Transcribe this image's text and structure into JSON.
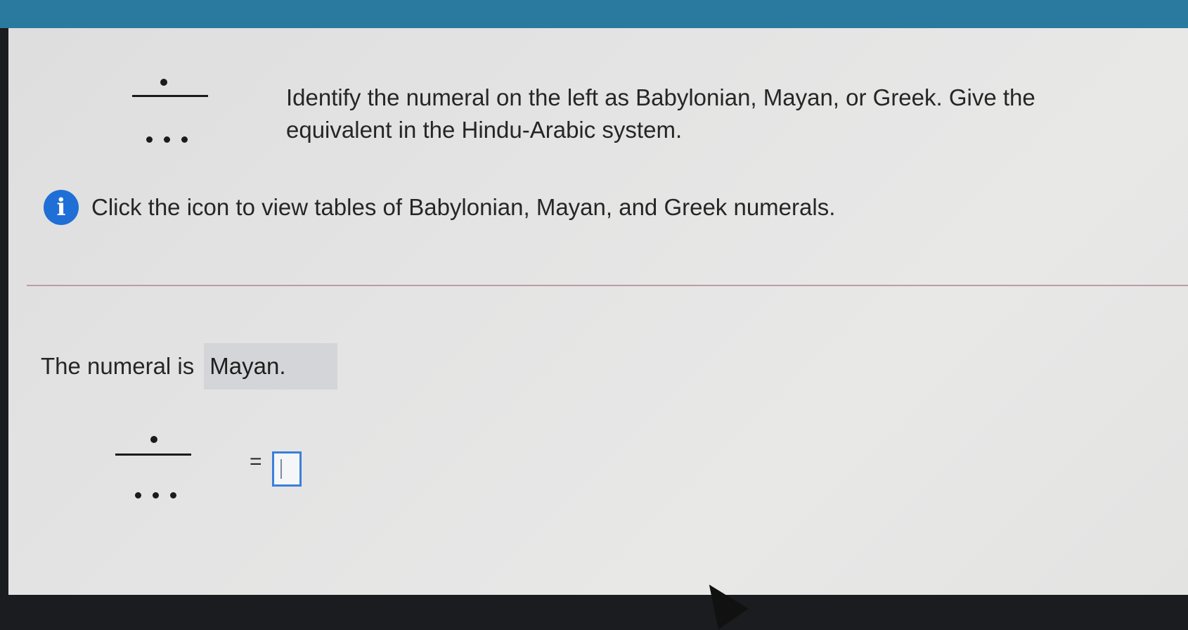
{
  "question": {
    "numeral_symbol": "mayan-numeral-one-dot-bar-three-dots",
    "text": "Identify the numeral on the left as Babylonian, Mayan, or Greek. Give the equivalent in the Hindu-Arabic system."
  },
  "info": {
    "icon_letter": "i",
    "icon": "info-icon",
    "text": "Click the icon to view tables of Babylonian, Mayan, and Greek numerals."
  },
  "answer": {
    "label": "The numeral is",
    "value": "Mayan.",
    "equals": "=",
    "input_value": ""
  },
  "colors": {
    "top_bar": "#2a7aa0",
    "info_icon": "#1f6fd6",
    "input_border": "#3b7fd9",
    "divider": "#b89fa5"
  }
}
